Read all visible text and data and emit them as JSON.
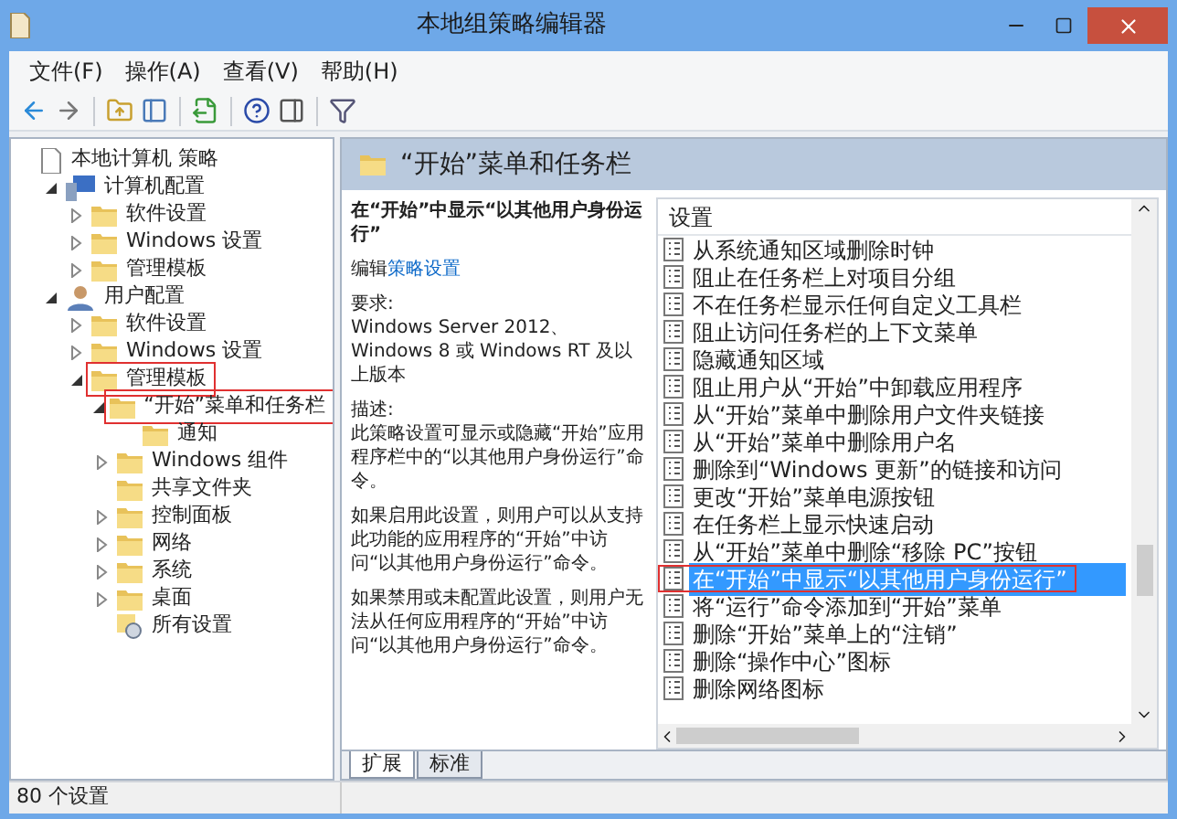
{
  "window": {
    "title": "本地组策略编辑器"
  },
  "menu": [
    "文件(F)",
    "操作(A)",
    "查看(V)",
    "帮助(H)"
  ],
  "tree": [
    {
      "label": "本地计算机 策略",
      "kind": "root",
      "children": [
        {
          "label": "计算机配置",
          "kind": "computer",
          "expandable": true,
          "expanded": true,
          "children": [
            {
              "label": "软件设置",
              "kind": "folder",
              "expandable": true,
              "expanded": false
            },
            {
              "label": "Windows 设置",
              "kind": "folder",
              "expandable": true,
              "expanded": false
            },
            {
              "label": "管理模板",
              "kind": "folder",
              "expandable": true,
              "expanded": false
            }
          ]
        },
        {
          "label": "用户配置",
          "kind": "user",
          "expandable": true,
          "expanded": true,
          "children": [
            {
              "label": "软件设置",
              "kind": "folder",
              "expandable": true,
              "expanded": false
            },
            {
              "label": "Windows 设置",
              "kind": "folder",
              "expandable": true,
              "expanded": false
            },
            {
              "label": "管理模板",
              "kind": "folder",
              "expandable": true,
              "expanded": true,
              "annotated": true,
              "children": [
                {
                  "label": "“开始”菜单和任务栏",
                  "kind": "folder",
                  "expandable": true,
                  "expanded": true,
                  "annotated": true,
                  "children": [
                    {
                      "label": "通知",
                      "kind": "folder",
                      "expandable": false,
                      "expanded": false
                    }
                  ]
                },
                {
                  "label": "Windows 组件",
                  "kind": "folder",
                  "expandable": true,
                  "expanded": false
                },
                {
                  "label": "共享文件夹",
                  "kind": "folder",
                  "expandable": false,
                  "expanded": false
                },
                {
                  "label": "控制面板",
                  "kind": "folder",
                  "expandable": true,
                  "expanded": false
                },
                {
                  "label": "网络",
                  "kind": "folder",
                  "expandable": true,
                  "expanded": false
                },
                {
                  "label": "系统",
                  "kind": "folder",
                  "expandable": true,
                  "expanded": false
                },
                {
                  "label": "桌面",
                  "kind": "folder",
                  "expandable": true,
                  "expanded": false
                },
                {
                  "label": "所有设置",
                  "kind": "all-settings",
                  "expandable": false,
                  "expanded": false
                }
              ]
            }
          ]
        }
      ]
    }
  ],
  "header": {
    "title": "“开始”菜单和任务栏"
  },
  "description": {
    "title": "在“开始”中显示“以其他用户身份运行”",
    "edit_prefix": "编辑",
    "edit_link": "策略设置",
    "paragraphs": [
      [
        "要求:",
        "Windows Server 2012、Windows 8 或 Windows RT 及以上版本"
      ],
      [
        "描述:",
        "此策略设置可显示或隐藏“开始”应用程序栏中的“以其他用户身份运行”命令。"
      ],
      [
        "如果启用此设置，则用户可以从支持此功能的应用程序的“开始”中访问“以其他用户身份运行”命令。"
      ],
      [
        "如果禁用或未配置此设置，则用户无法从任何应用程序的“开始”中访问“以其他用户身份运行”命令。"
      ]
    ]
  },
  "settings": {
    "column": "设置",
    "rows": [
      {
        "label": "从系统通知区域删除时钟",
        "selected": false,
        "annotated": false
      },
      {
        "label": "阻止在任务栏上对项目分组",
        "selected": false,
        "annotated": false
      },
      {
        "label": "不在任务栏显示任何自定义工具栏",
        "selected": false,
        "annotated": false
      },
      {
        "label": "阻止访问任务栏的上下文菜单",
        "selected": false,
        "annotated": false
      },
      {
        "label": "隐藏通知区域",
        "selected": false,
        "annotated": false
      },
      {
        "label": "阻止用户从“开始”中卸载应用程序",
        "selected": false,
        "annotated": false
      },
      {
        "label": "从“开始”菜单中删除用户文件夹链接",
        "selected": false,
        "annotated": false
      },
      {
        "label": "从“开始”菜单中删除用户名",
        "selected": false,
        "annotated": false
      },
      {
        "label": "删除到“Windows 更新”的链接和访问",
        "selected": false,
        "annotated": false
      },
      {
        "label": "更改“开始”菜单电源按钮",
        "selected": false,
        "annotated": false
      },
      {
        "label": "在任务栏上显示快速启动",
        "selected": false,
        "annotated": false
      },
      {
        "label": "从“开始”菜单中删除“移除 PC”按钮",
        "selected": false,
        "annotated": false
      },
      {
        "label": "在“开始”中显示“以其他用户身份运行”",
        "selected": true,
        "annotated": true
      },
      {
        "label": "将“运行”命令添加到“开始”菜单",
        "selected": false,
        "annotated": false
      },
      {
        "label": "删除“开始”菜单上的“注销”",
        "selected": false,
        "annotated": false
      },
      {
        "label": "删除“操作中心”图标",
        "selected": false,
        "annotated": false
      },
      {
        "label": "删除网络图标",
        "selected": false,
        "annotated": false
      }
    ]
  },
  "tabs": [
    {
      "label": "扩展",
      "selected": true
    },
    {
      "label": "标准",
      "selected": false
    }
  ],
  "status_bar": "80 个设置"
}
